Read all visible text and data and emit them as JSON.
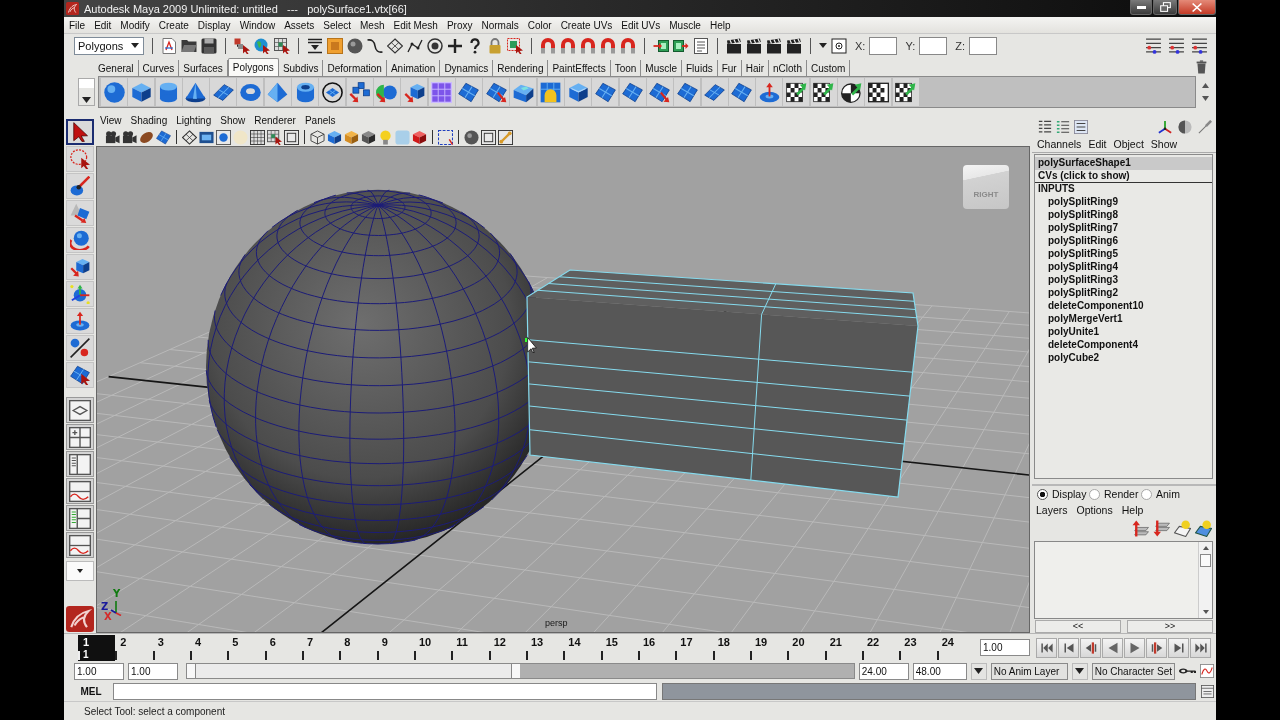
{
  "window": {
    "title": "Autodesk Maya 2009 Unlimited: untitled   ---   polySurface1.vtx[66]"
  },
  "menu_bar": [
    "File",
    "Edit",
    "Modify",
    "Create",
    "Display",
    "Window",
    "Assets",
    "Select",
    "Mesh",
    "Edit Mesh",
    "Proxy",
    "Normals",
    "Color",
    "Create UVs",
    "Edit UVs",
    "Muscle",
    "Help"
  ],
  "status_line": {
    "menu_set": "Polygons",
    "coordinate_labels": [
      "X:",
      "Y:",
      "Z:"
    ]
  },
  "shelf_tabs": [
    {
      "label": "General",
      "selected": false
    },
    {
      "label": "Curves",
      "selected": false
    },
    {
      "label": "Surfaces",
      "selected": false
    },
    {
      "label": "Polygons",
      "selected": true
    },
    {
      "label": "Subdivs",
      "selected": false
    },
    {
      "label": "Deformation",
      "selected": false
    },
    {
      "label": "Animation",
      "selected": false
    },
    {
      "label": "Dynamics",
      "selected": false
    },
    {
      "label": "Rendering",
      "selected": false
    },
    {
      "label": "PaintEffects",
      "selected": false
    },
    {
      "label": "Toon",
      "selected": false
    },
    {
      "label": "Muscle",
      "selected": false
    },
    {
      "label": "Fluids",
      "selected": false
    },
    {
      "label": "Fur",
      "selected": false
    },
    {
      "label": "Hair",
      "selected": false
    },
    {
      "label": "nCloth",
      "selected": false
    },
    {
      "label": "Custom",
      "selected": false
    }
  ],
  "toolbox": {
    "tools": [
      {
        "selected": true
      },
      {
        "selected": false
      },
      {
        "selected": false
      },
      {
        "selected": false
      },
      {
        "selected": false
      },
      {
        "selected": false
      },
      {
        "selected": false
      },
      {
        "selected": false
      },
      {
        "selected": false
      },
      {
        "selected": false
      }
    ]
  },
  "viewport": {
    "menu": [
      "View",
      "Shading",
      "Lighting",
      "Show",
      "Renderer",
      "Panels"
    ],
    "view_cube_label": "RIGHT",
    "camera_name": "persp",
    "axes": [
      {
        "label": "Y",
        "color": "#0f7a0f"
      },
      {
        "label": "Z",
        "color": "#1a1a9c"
      },
      {
        "label": "X",
        "color": "#d42a2a"
      }
    ]
  },
  "channel_box": {
    "menu": [
      "Channels",
      "Edit",
      "Object",
      "Show"
    ],
    "shape_node": "polySurfaceShape1",
    "cvs_row": "CVs (click to show)",
    "inputs_heading": "INPUTS",
    "inputs": [
      "polySplitRing9",
      "polySplitRing8",
      "polySplitRing7",
      "polySplitRing6",
      "polySplitRing5",
      "polySplitRing4",
      "polySplitRing3",
      "polySplitRing2",
      "deleteComponent10",
      "polyMergeVert1",
      "polyUnite1",
      "deleteComponent4",
      "polyCube2"
    ]
  },
  "layer_editor": {
    "modes": [
      {
        "label": "Display",
        "selected": true
      },
      {
        "label": "Render",
        "selected": false
      },
      {
        "label": "Anim",
        "selected": false
      }
    ],
    "menu": [
      "Layers",
      "Options",
      "Help"
    ],
    "page_buttons": [
      "<<",
      ">>"
    ]
  },
  "time_slider": {
    "frames": [
      {
        "label": "1",
        "selected": true
      },
      {
        "label": "2",
        "selected": false
      },
      {
        "label": "3",
        "selected": false
      },
      {
        "label": "4",
        "selected": false
      },
      {
        "label": "5",
        "selected": false
      },
      {
        "label": "6",
        "selected": false
      },
      {
        "label": "7",
        "selected": false
      },
      {
        "label": "8",
        "selected": false
      },
      {
        "label": "9",
        "selected": false
      },
      {
        "label": "10",
        "selected": false
      },
      {
        "label": "11",
        "selected": false
      },
      {
        "label": "12",
        "selected": false
      },
      {
        "label": "13",
        "selected": false
      },
      {
        "label": "14",
        "selected": false
      },
      {
        "label": "15",
        "selected": false
      },
      {
        "label": "16",
        "selected": false
      },
      {
        "label": "17",
        "selected": false
      },
      {
        "label": "18",
        "selected": false
      },
      {
        "label": "19",
        "selected": false
      },
      {
        "label": "20",
        "selected": false
      },
      {
        "label": "21",
        "selected": false
      },
      {
        "label": "22",
        "selected": false
      },
      {
        "label": "23",
        "selected": false
      },
      {
        "label": "24",
        "selected": false
      }
    ],
    "current_frame_marker": "1",
    "current_time": "1.00"
  },
  "range_slider": {
    "start_time": "1.00",
    "playback_start": "1.00",
    "level": 0.5,
    "playback_end": "24.00",
    "end_time": "48.00",
    "anim_layer": "No Anim Layer",
    "character_set": "No Character Set"
  },
  "command_line": {
    "language": "MEL"
  },
  "help_line": "Select Tool: select a component"
}
